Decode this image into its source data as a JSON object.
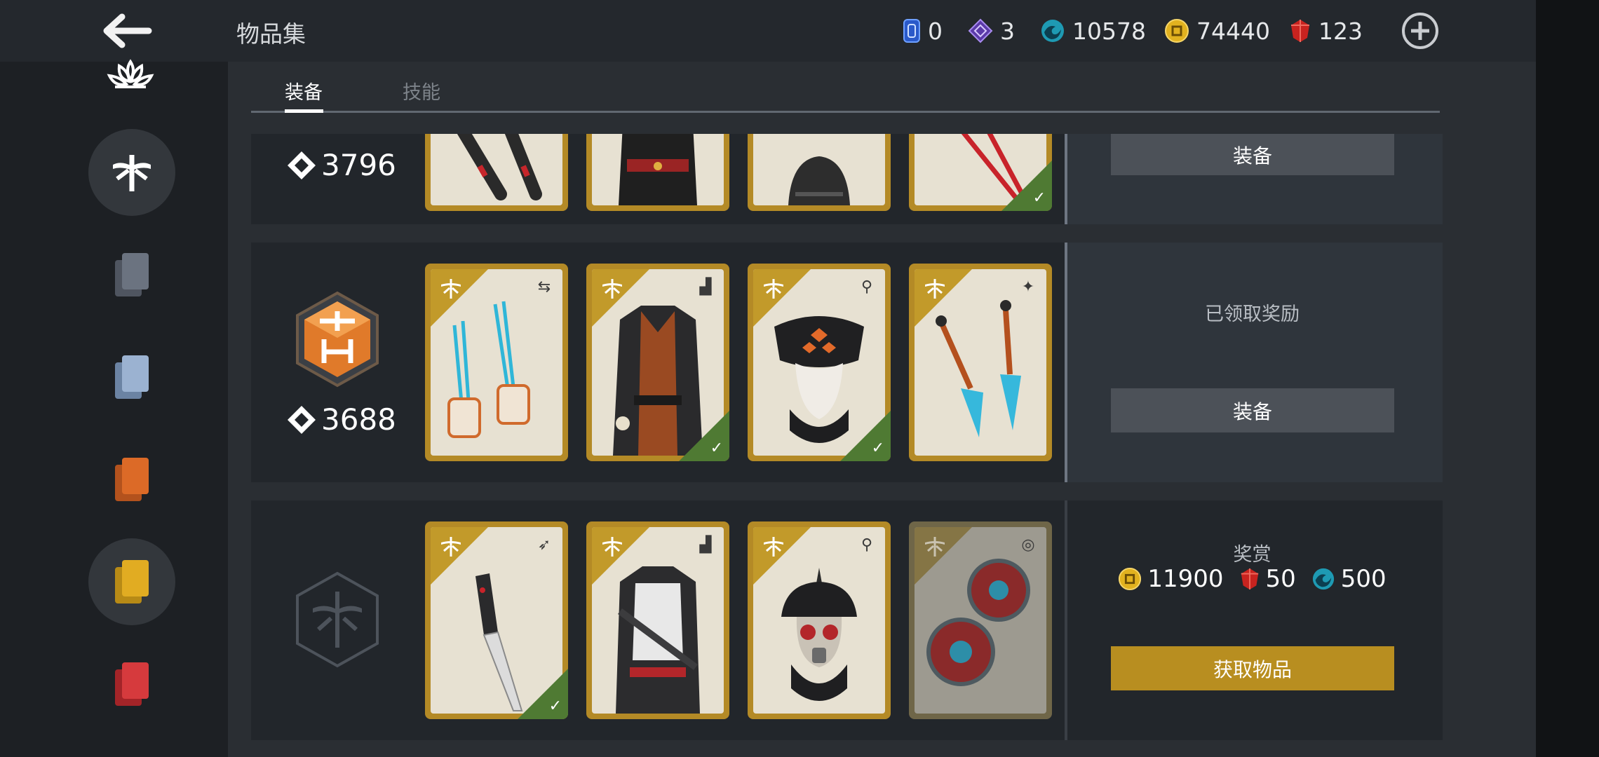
{
  "header": {
    "title": "物品集",
    "currencies": [
      {
        "icon": "ticket-icon",
        "value": "0"
      },
      {
        "icon": "diamond-shard-icon",
        "value": "3"
      },
      {
        "icon": "spirit-orb-icon",
        "value": "10578"
      },
      {
        "icon": "coin-icon",
        "value": "74440"
      },
      {
        "icon": "ruby-icon",
        "value": "123"
      }
    ]
  },
  "tabs": [
    {
      "label": "装备",
      "active": true
    },
    {
      "label": "技能",
      "active": false
    }
  ],
  "sidebar": {
    "items": [
      {
        "icon": "dragonfly-emblem-icon",
        "active": true
      },
      {
        "icon": "card-stack-gray-icon",
        "active": false
      },
      {
        "icon": "card-stack-blue-icon",
        "active": false
      },
      {
        "icon": "card-stack-orange-icon",
        "active": false
      },
      {
        "icon": "card-stack-gold-icon",
        "active": true
      },
      {
        "icon": "card-stack-red-icon",
        "active": false
      }
    ]
  },
  "sets": [
    {
      "points": "3796",
      "items": [
        {
          "name": "twin-blades",
          "owned": false
        },
        {
          "name": "armor-vest",
          "owned": false
        },
        {
          "name": "helmet",
          "owned": false
        },
        {
          "name": "red-daggers",
          "owned": true
        }
      ],
      "action_label": "装备"
    },
    {
      "points": "3688",
      "status": "已领取奖励",
      "items": [
        {
          "name": "claw-gauntlets",
          "type_icon": "swap-icon",
          "owned": false
        },
        {
          "name": "ninja-coat",
          "type_icon": "armor-icon",
          "owned": true
        },
        {
          "name": "straw-hat-mask",
          "type_icon": "helmet-icon",
          "owned": true
        },
        {
          "name": "ice-kunai",
          "type_icon": "magic-icon",
          "owned": false
        }
      ],
      "action_label": "装备"
    },
    {
      "items": [
        {
          "name": "combat-knife",
          "type_icon": "blade-icon",
          "owned": true
        },
        {
          "name": "tactical-armor",
          "type_icon": "armor-icon",
          "owned": false
        },
        {
          "name": "gas-mask-helmet",
          "type_icon": "helmet-icon",
          "owned": false
        },
        {
          "name": "chakram",
          "type_icon": "ranged-icon",
          "owned": false
        }
      ],
      "reward": {
        "title": "奖赏",
        "coins": "11900",
        "rubies": "50",
        "orbs": "500"
      },
      "action_label": "获取物品"
    }
  ],
  "colors": {
    "accent_gold": "#b88e20",
    "owned_green": "#4f7a33",
    "panel_bg": "#2a2e33"
  }
}
